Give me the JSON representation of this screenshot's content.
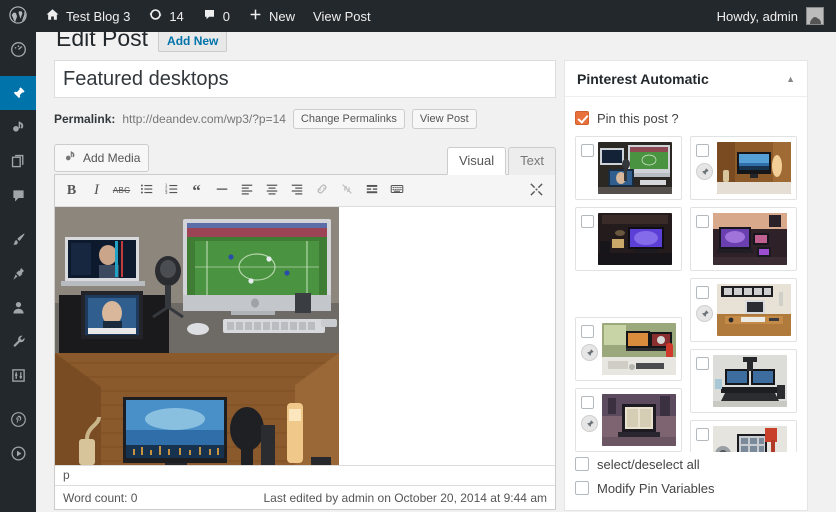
{
  "adminbar": {
    "logo_icon": "wordpress-logo-icon",
    "site_name": "Test Blog 3",
    "home_icon": "home-icon",
    "updates_icon": "updates-icon",
    "updates_count": "14",
    "comments_icon": "comment-bubble-icon",
    "comments_count": "0",
    "new_icon": "plus-icon",
    "new_label": "New",
    "view_post_label": "View Post",
    "howdy": "Howdy, admin",
    "avatar_icon": "avatar-icon",
    "background": "#23282d"
  },
  "adminmenu": {
    "active_color": "#0073aa",
    "items": [
      {
        "name": "dashboard",
        "icon": "dashboard-icon",
        "active": false
      },
      {
        "name": "posts",
        "icon": "pin-icon",
        "active": true
      },
      {
        "name": "media",
        "icon": "media-icon",
        "active": false
      },
      {
        "name": "pages",
        "icon": "pages-icon",
        "active": false
      },
      {
        "name": "comments",
        "icon": "comment-bubble-icon",
        "active": false
      },
      {
        "name": "appearance",
        "icon": "paintbrush-icon",
        "active": false
      },
      {
        "name": "plugins",
        "icon": "plug-icon",
        "active": false
      },
      {
        "name": "users",
        "icon": "user-icon",
        "active": false
      },
      {
        "name": "tools",
        "icon": "wrench-icon",
        "active": false
      },
      {
        "name": "settings",
        "icon": "sliders-icon",
        "active": false
      },
      {
        "name": "pinterest",
        "icon": "pinterest-icon",
        "active": false
      },
      {
        "name": "media-player",
        "icon": "play-circle-icon",
        "active": false
      }
    ]
  },
  "page": {
    "title": "Edit Post",
    "add_new_label": "Add New"
  },
  "post": {
    "title_value": "Featured desktops",
    "title_placeholder": "Enter title here",
    "permalink_label": "Permalink:",
    "permalink_url": "http://deandev.com/wp3/?p=14",
    "change_permalinks_label": "Change Permalinks",
    "view_post_label": "View Post"
  },
  "editor": {
    "add_media_label": "Add Media",
    "add_media_icon": "media-icon",
    "tabs": [
      {
        "label": "Visual",
        "active": true
      },
      {
        "label": "Text",
        "active": false
      }
    ],
    "toolbar": [
      {
        "name": "bold-button",
        "icon": "bold-icon",
        "glyph": "B",
        "dim": false
      },
      {
        "name": "italic-button",
        "icon": "italic-icon",
        "glyph": "I",
        "dim": false
      },
      {
        "name": "strikethrough-button",
        "icon": "strikethrough-icon",
        "glyph": "ABC",
        "dim": false
      },
      {
        "name": "bullet-list-button",
        "icon": "bullet-list-icon",
        "glyph": "",
        "dim": false
      },
      {
        "name": "numbered-list-button",
        "icon": "numbered-list-icon",
        "glyph": "",
        "dim": false
      },
      {
        "name": "blockquote-button",
        "icon": "quote-icon",
        "glyph": "“",
        "dim": false
      },
      {
        "name": "horizontal-rule-button",
        "icon": "horizontal-rule-icon",
        "glyph": "—",
        "dim": false
      },
      {
        "name": "align-left-button",
        "icon": "align-left-icon",
        "glyph": "",
        "dim": false
      },
      {
        "name": "align-center-button",
        "icon": "align-center-icon",
        "glyph": "",
        "dim": false
      },
      {
        "name": "align-right-button",
        "icon": "align-right-icon",
        "glyph": "",
        "dim": false
      },
      {
        "name": "insert-link-button",
        "icon": "link-icon",
        "glyph": "",
        "dim": true
      },
      {
        "name": "unlink-button",
        "icon": "unlink-icon",
        "glyph": "",
        "dim": true
      },
      {
        "name": "read-more-button",
        "icon": "more-tag-icon",
        "glyph": "",
        "dim": false
      },
      {
        "name": "kitchen-sink-button",
        "icon": "keyboard-icon",
        "glyph": "",
        "dim": false
      }
    ],
    "fullscreen_icon": "fullscreen-icon",
    "content_images": [
      {
        "name": "desktop-photo-imac-soccer",
        "alt": "iMac with soccer match, laptop and tablet on desk"
      },
      {
        "name": "desktop-photo-wood-room",
        "alt": "Monitor on desk in wood panelled room"
      }
    ],
    "path_indicator": "p",
    "word_count": "Word count: 0",
    "last_edited": "Last edited by admin on October 20, 2014 at 9:44 am"
  },
  "metabox": {
    "title": "Pinterest Automatic",
    "toggle_icon": "chevron-up-icon",
    "pin_this_post_label": "Pin this post ?",
    "pin_this_post_checked": true,
    "accent_color": "#e8703a",
    "select_all_label": "select/deselect all",
    "select_all_checked": false,
    "modify_vars_label": "Modify Pin Variables",
    "modify_vars_checked": false,
    "grid": {
      "left": [
        {
          "name": "pin-image-1",
          "checked": false,
          "has_pin_badge": false,
          "offset": false
        },
        {
          "name": "pin-image-3",
          "checked": false,
          "has_pin_badge": false,
          "offset": false
        },
        {
          "name": "pin-image-spacer",
          "spacer": true
        },
        {
          "name": "pin-image-6",
          "checked": false,
          "has_pin_badge": true,
          "offset": false
        },
        {
          "name": "pin-image-8",
          "checked": false,
          "has_pin_badge": true,
          "offset": false
        }
      ],
      "right": [
        {
          "name": "pin-image-2",
          "checked": false,
          "has_pin_badge": true,
          "offset": false
        },
        {
          "name": "pin-image-4",
          "checked": false,
          "has_pin_badge": false,
          "offset": false
        },
        {
          "name": "pin-image-5",
          "checked": false,
          "has_pin_badge": true,
          "offset": false
        },
        {
          "name": "pin-image-7",
          "checked": false,
          "has_pin_badge": false,
          "offset": false
        },
        {
          "name": "pin-image-9",
          "checked": false,
          "has_pin_badge": false,
          "offset": false
        }
      ]
    }
  }
}
